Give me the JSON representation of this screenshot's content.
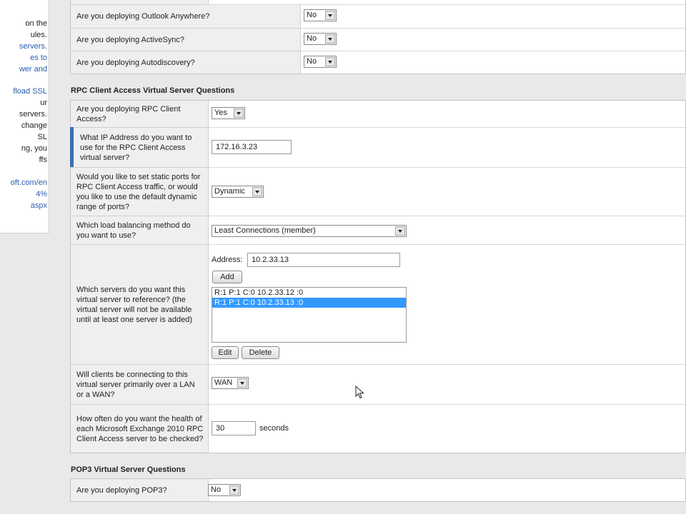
{
  "sidebar": {
    "lines": [
      {
        "text": "on the",
        "color": "dark"
      },
      {
        "text": "ules.",
        "color": "dark"
      },
      {
        "text": "servers.",
        "color": "link"
      },
      {
        "text": "es to",
        "color": "link"
      },
      {
        "text": "wer and",
        "color": "link"
      },
      {
        "text": "fload SSL",
        "color": "link"
      },
      {
        "text": "ur",
        "color": "dark"
      },
      {
        "text": "servers.",
        "color": "dark"
      },
      {
        "text": "change",
        "color": "dark"
      },
      {
        "text": "SL",
        "color": "dark"
      },
      {
        "text": "ng, you",
        "color": "dark"
      },
      {
        "text": "ffs",
        "color": "dark"
      },
      {
        "text": "oft.com/en",
        "color": "link"
      },
      {
        "text": "4%",
        "color": "link"
      },
      {
        "text": "aspx",
        "color": "link"
      }
    ]
  },
  "top_section": {
    "rows": [
      {
        "question": "Are you deploying Outlook Anywhere?",
        "value": "No"
      },
      {
        "question": "Are you deploying ActiveSync?",
        "value": "No"
      },
      {
        "question": "Are you deploying Autodiscovery?",
        "value": "No"
      }
    ]
  },
  "rpc_section": {
    "heading": "RPC Client Access Virtual Server Questions",
    "q_deploying": "Are you deploying RPC Client Access?",
    "a_deploying": "Yes",
    "q_ip": "What IP Address do you want to use for the RPC Client Access virtual server?",
    "a_ip": "172.16.3.23",
    "q_ports": "Would you like to set static ports for RPC Client Access traffic, or would you like to use the default dynamic range of ports?",
    "a_ports": "Dynamic",
    "q_lb": "Which load balancing method do you want to use?",
    "a_lb": "Least Connections (member)",
    "q_servers": "Which servers do you want this virtual server to reference? (the virtual server will not be available until at least one server is added)",
    "address_label": "Address:",
    "address_value": "10.2.33.13",
    "add_label": "Add",
    "server_list": [
      {
        "text": "R:1 P:1 C:0 10.2.33.12 :0",
        "selected": false
      },
      {
        "text": "R:1 P:1 C:0 10.2.33.13 :0",
        "selected": true
      }
    ],
    "edit_label": "Edit",
    "delete_label": "Delete",
    "q_wan": "Will clients be connecting to this virtual server primarily over a LAN or a WAN?",
    "a_wan": "WAN",
    "q_health": "How often do you want the health of each Microsoft Exchange 2010 RPC Client Access server to be checked?",
    "a_health": "30",
    "health_unit": "seconds"
  },
  "pop3_section": {
    "heading": "POP3 Virtual Server Questions",
    "q_deploying": "Are you deploying POP3?",
    "a_deploying": "No"
  }
}
